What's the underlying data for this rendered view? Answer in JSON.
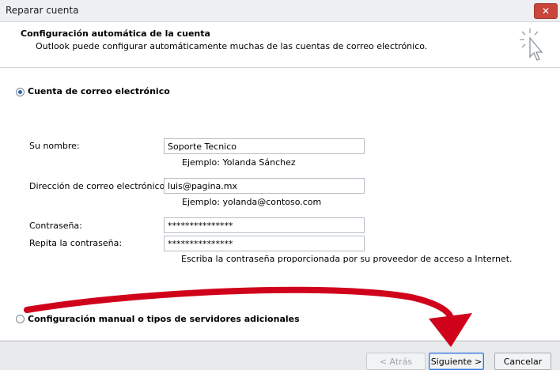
{
  "window": {
    "title": "Reparar cuenta",
    "close_label": "✕"
  },
  "header": {
    "title": "Configuración automática de la cuenta",
    "subtitle": "Outlook puede configurar automáticamente muchas de las cuentas de correo electrónico.",
    "icon": "wizard-cursor-icon"
  },
  "options": {
    "email_account_label": "Cuenta de correo electrónico",
    "manual_label": "Configuración manual o tipos de servidores adicionales"
  },
  "form": {
    "name_label": "Su nombre:",
    "name_value": "Soporte Tecnico",
    "name_hint": "Ejemplo: Yolanda Sánchez",
    "email_label": "Dirección de correo electrónico:",
    "email_value": "luis@pagina.mx",
    "email_hint": "Ejemplo: yolanda@contoso.com",
    "password_label": "Contraseña:",
    "password_value": "***************",
    "repeat_label": "Repita la contraseña:",
    "repeat_value": "***************",
    "password_hint": "Escriba la contraseña proporcionada por su proveedor de acceso a Internet."
  },
  "footer": {
    "back_label": "< Atrás",
    "next_label": "Siguiente >",
    "cancel_label": "Cancelar"
  },
  "colors": {
    "annotation_arrow": "#d0021b",
    "accent": "#2b67b0"
  }
}
